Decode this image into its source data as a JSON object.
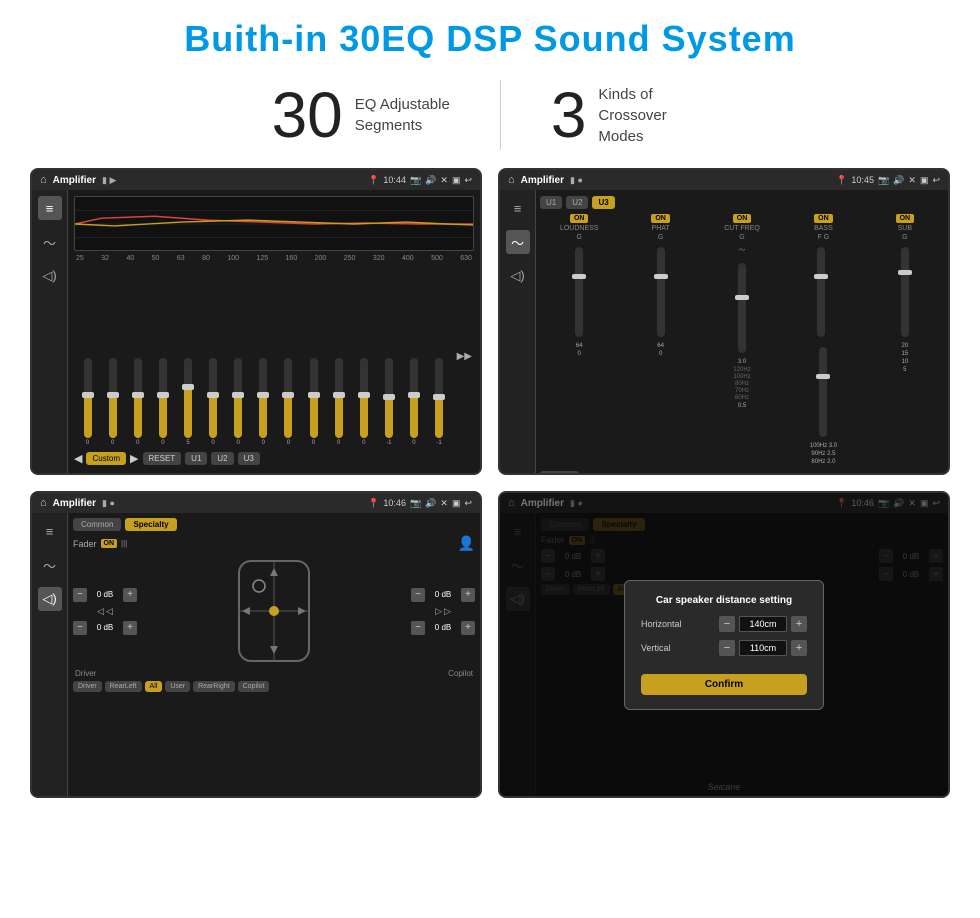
{
  "page": {
    "title": "Buith-in 30EQ DSP Sound System",
    "stats": [
      {
        "number": "30",
        "label": "EQ Adjustable\nSegments"
      },
      {
        "number": "3",
        "label": "Kinds of\nCrossover Modes"
      }
    ]
  },
  "screens": {
    "eq_screen": {
      "status_time": "10:44",
      "app_name": "Amplifier",
      "freq_labels": [
        "25",
        "32",
        "40",
        "50",
        "63",
        "80",
        "100",
        "125",
        "160",
        "200",
        "250",
        "320",
        "400",
        "500",
        "630"
      ],
      "slider_values": [
        "0",
        "0",
        "0",
        "0",
        "5",
        "0",
        "0",
        "0",
        "0",
        "0",
        "0",
        "0",
        "-1",
        "0",
        "-1"
      ],
      "bottom_btns": [
        "Custom",
        "RESET",
        "U1",
        "U2",
        "U3"
      ]
    },
    "crossover_screen": {
      "status_time": "10:45",
      "app_name": "Amplifier",
      "presets": [
        "U1",
        "U2",
        "U3"
      ],
      "active_preset": "U3",
      "cols": [
        {
          "label": "LOUDNESS",
          "on": true,
          "type": "G"
        },
        {
          "label": "PHAT",
          "on": true,
          "type": "G"
        },
        {
          "label": "CUT FREQ",
          "on": true,
          "type": "G"
        },
        {
          "label": "BASS",
          "on": true,
          "type": "F G"
        },
        {
          "label": "SUB",
          "on": true,
          "type": "G"
        }
      ],
      "reset_label": "RESET"
    },
    "specialty_screen": {
      "status_time": "10:46",
      "app_name": "Amplifier",
      "modes": [
        "Common",
        "Specialty"
      ],
      "active_mode": "Specialty",
      "fader_label": "Fader",
      "fader_on": "ON",
      "db_rows": [
        {
          "label": "0 dB",
          "pos": "top-left"
        },
        {
          "label": "0 dB",
          "pos": "top-right"
        },
        {
          "label": "0 dB",
          "pos": "bottom-left"
        },
        {
          "label": "0 dB",
          "pos": "bottom-right"
        }
      ],
      "buttons": [
        "Driver",
        "RearLeft",
        "All",
        "User",
        "RearRight",
        "Copilot"
      ]
    },
    "dialog_screen": {
      "status_time": "10:46",
      "app_name": "Amplifier",
      "dialog": {
        "title": "Car speaker distance setting",
        "rows": [
          {
            "label": "Horizontal",
            "value": "140cm"
          },
          {
            "label": "Vertical",
            "value": "110cm"
          }
        ],
        "confirm_label": "Confirm"
      }
    }
  },
  "watermark": "Seicane"
}
